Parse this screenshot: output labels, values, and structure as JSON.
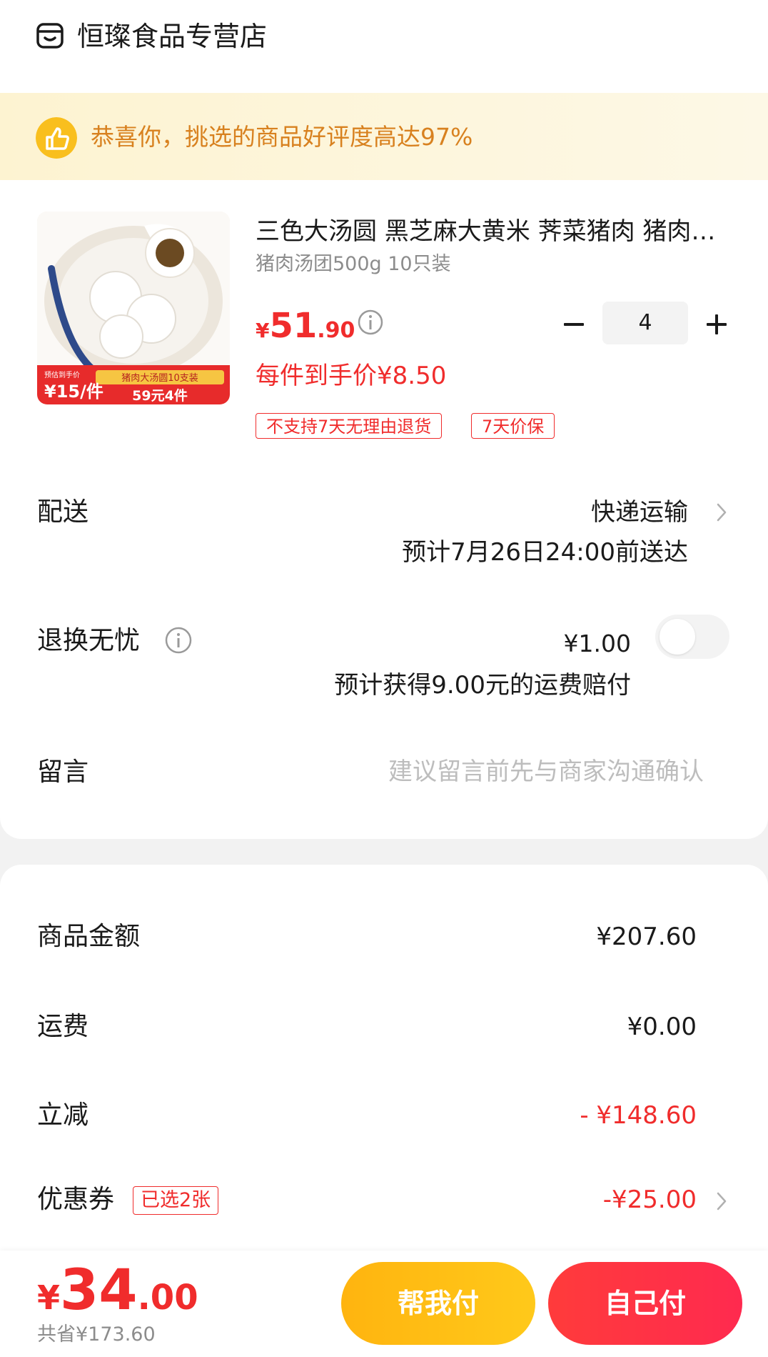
{
  "store": {
    "name": "恒璨食品专营店"
  },
  "banner": {
    "text": "恭喜你，挑选的商品好评度高达97%"
  },
  "product": {
    "title": "三色大汤圆 黑芝麻大黄米 荠菜猪肉 猪肉汤团",
    "subtitle": "猪肉汤团500g 10只装",
    "price_symbol": "¥",
    "price_int": "51",
    "price_dec": ".90",
    "per_item_price": "每件到手价¥8.50",
    "tags": [
      "不支持7天无理由退货",
      "7天价保"
    ],
    "quantity": "4",
    "image_badge": {
      "label": "预估到手价",
      "price": "¥15/件",
      "promo": "猪肉大汤圆10支装",
      "deal": "59元4件"
    }
  },
  "delivery": {
    "label": "配送",
    "method": "快递运输",
    "eta": "预计7月26日24:00前送达"
  },
  "return_service": {
    "label": "退换无忧",
    "price": "¥1.00",
    "compensation": "预计获得9.00元的运费赔付",
    "enabled": false
  },
  "message": {
    "label": "留言",
    "placeholder": "建议留言前先与商家沟通确认"
  },
  "summary": {
    "goods_label": "商品金额",
    "goods_value": "¥207.60",
    "shipping_label": "运费",
    "shipping_value": "¥0.00",
    "discount_label": "立减",
    "discount_value": "- ¥148.60",
    "coupon_label": "优惠券",
    "coupon_badge": "已选2张",
    "coupon_value": "-¥25.00"
  },
  "footer": {
    "total_symbol": "¥",
    "total_int": "34",
    "total_dec": ".00",
    "saved": "共省¥173.60",
    "help_pay_label": "帮我付",
    "self_pay_label": "自己付"
  },
  "colors": {
    "accent_red": "#f02c2c",
    "accent_yellow": "#ffb40f",
    "banner_text": "#d8811f"
  },
  "icons": [
    "store-icon",
    "thumbs-up-icon",
    "info-icon",
    "minus-icon",
    "plus-icon",
    "chevron-right-icon"
  ]
}
